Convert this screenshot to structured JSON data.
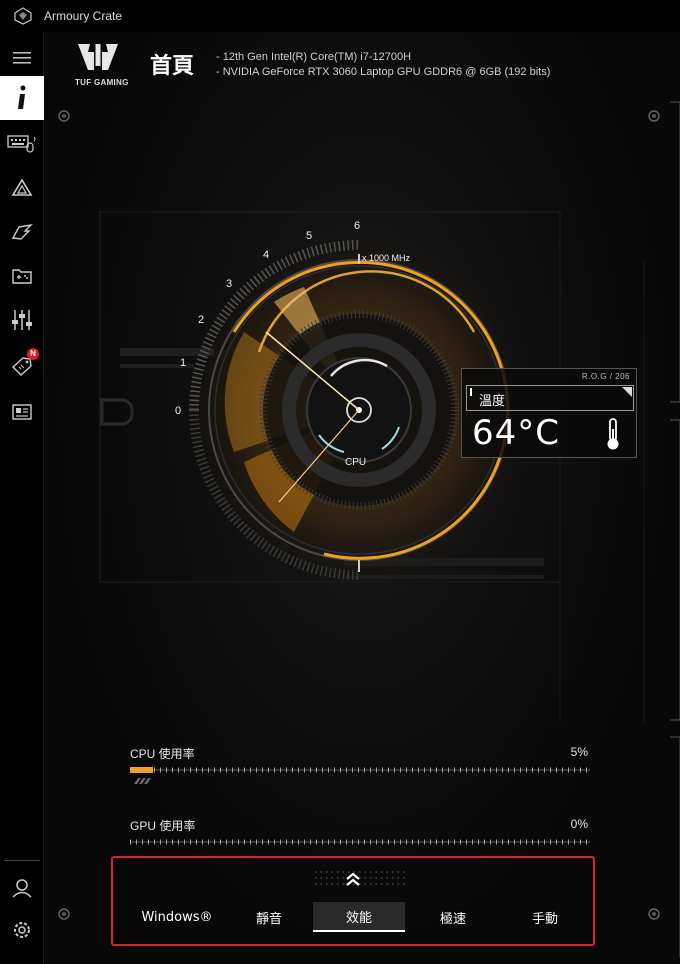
{
  "window": {
    "title": "Armoury Crate"
  },
  "sidebar": {
    "items": [
      {
        "name": "home",
        "icon": "info-icon",
        "active": true
      },
      {
        "name": "keyboard",
        "icon": "keyboard-icon"
      },
      {
        "name": "aura",
        "icon": "aura-triangle-icon"
      },
      {
        "name": "gamevisual",
        "icon": "visual-icon"
      },
      {
        "name": "library",
        "icon": "game-library-icon"
      },
      {
        "name": "settings-sliders",
        "icon": "sliders-icon"
      },
      {
        "name": "deals",
        "icon": "deals-tag-icon",
        "badge": "N"
      },
      {
        "name": "news",
        "icon": "news-icon"
      }
    ],
    "bottom": [
      {
        "name": "account",
        "icon": "user-icon"
      },
      {
        "name": "settings",
        "icon": "gear-icon"
      }
    ]
  },
  "header": {
    "brand": "TUF GAMING",
    "title": "首頁",
    "specs": [
      "-   12th Gen Intel(R) Core(TM) i7-12700H",
      "-   NVIDIA GeForce RTX 3060 Laptop GPU GDDR6 @ 6GB (192 bits)"
    ]
  },
  "gauge": {
    "ticks": [
      "0",
      "1",
      "2",
      "3",
      "4",
      "5",
      "6"
    ],
    "unit": "x 1000 MHz",
    "center_label": "CPU",
    "accent": "#f0a020"
  },
  "temperature": {
    "tag": "R.O.G / 206",
    "label": "溫度",
    "value": "64°C"
  },
  "usage": {
    "cpu": {
      "label": "CPU 使用率",
      "value": "5%",
      "fraction": 0.05
    },
    "gpu": {
      "label": "GPU 使用率",
      "value": "0%",
      "fraction": 0.0
    }
  },
  "modes": {
    "items": [
      "Windows®",
      "靜音",
      "效能",
      "極速",
      "手動"
    ],
    "active": "效能",
    "highlight_color": "#d7262a"
  }
}
